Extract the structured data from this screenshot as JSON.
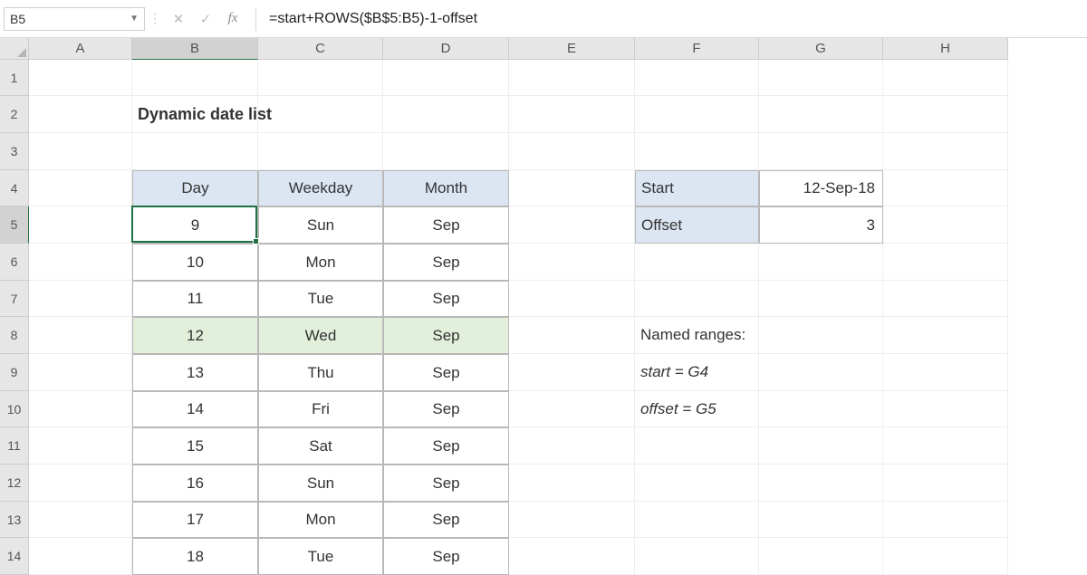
{
  "namebox": {
    "value": "B5",
    "dropdown_icon": "▼"
  },
  "formulabar": {
    "divider_icon": "⋮",
    "cancel_icon": "✕",
    "enter_icon": "✓",
    "fx_label": "fx",
    "formula": "=start+ROWS($B$5:B5)-1-offset"
  },
  "columns": [
    {
      "label": "A",
      "width": 114
    },
    {
      "label": "B",
      "width": 139,
      "active": true
    },
    {
      "label": "C",
      "width": 138
    },
    {
      "label": "D",
      "width": 139
    },
    {
      "label": "E",
      "width": 139
    },
    {
      "label": "F",
      "width": 137
    },
    {
      "label": "G",
      "width": 137
    },
    {
      "label": "H",
      "width": 138
    }
  ],
  "rows": [
    {
      "label": "1",
      "height": 40
    },
    {
      "label": "2",
      "height": 41
    },
    {
      "label": "3",
      "height": 41
    },
    {
      "label": "4",
      "height": 40
    },
    {
      "label": "5",
      "height": 41,
      "active": true
    },
    {
      "label": "6",
      "height": 41
    },
    {
      "label": "7",
      "height": 40
    },
    {
      "label": "8",
      "height": 41
    },
    {
      "label": "9",
      "height": 41
    },
    {
      "label": "10",
      "height": 40
    },
    {
      "label": "11",
      "height": 41
    },
    {
      "label": "12",
      "height": 41
    },
    {
      "label": "13",
      "height": 40
    },
    {
      "label": "14",
      "height": 41
    }
  ],
  "title": "Dynamic date list",
  "table": {
    "headers": {
      "day": "Day",
      "weekday": "Weekday",
      "month": "Month"
    },
    "rows": [
      {
        "day": "9",
        "weekday": "Sun",
        "month": "Sep"
      },
      {
        "day": "10",
        "weekday": "Mon",
        "month": "Sep"
      },
      {
        "day": "11",
        "weekday": "Tue",
        "month": "Sep"
      },
      {
        "day": "12",
        "weekday": "Wed",
        "month": "Sep",
        "highlight": true
      },
      {
        "day": "13",
        "weekday": "Thu",
        "month": "Sep"
      },
      {
        "day": "14",
        "weekday": "Fri",
        "month": "Sep"
      },
      {
        "day": "15",
        "weekday": "Sat",
        "month": "Sep"
      },
      {
        "day": "16",
        "weekday": "Sun",
        "month": "Sep"
      },
      {
        "day": "17",
        "weekday": "Mon",
        "month": "Sep"
      },
      {
        "day": "18",
        "weekday": "Tue",
        "month": "Sep"
      }
    ]
  },
  "params": {
    "start_label": "Start",
    "start_value": "12-Sep-18",
    "offset_label": "Offset",
    "offset_value": "3"
  },
  "notes": {
    "heading": "Named ranges:",
    "line1": "start = G4",
    "line2": "offset = G5"
  },
  "active_cell": {
    "col": 1,
    "row": 4
  }
}
